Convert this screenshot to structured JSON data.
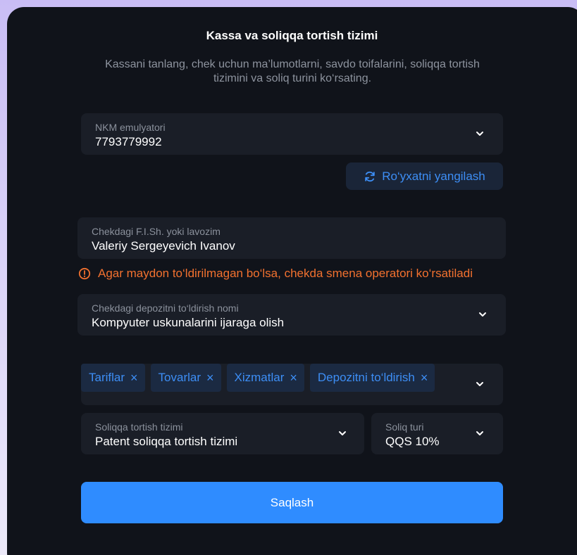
{
  "header": {
    "title": "Kassa va soliqqa tortish tizimi",
    "subtitle": "Kassani tanlang, chek uchun ma’lumotlarni, savdo toifalarini, soliqqa tortish tizimini va soliq turini ko‘rsating."
  },
  "cash_register": {
    "label": "NKM emulyatori",
    "value": "7793779992"
  },
  "refresh_button": {
    "label": "Ro‘yxatni yangilash"
  },
  "cashier_name": {
    "label": "Chekdagi F.I.Sh. yoki lavozim",
    "value": "Valeriy Sergeyevich Ivanov"
  },
  "warning": {
    "text": "Agar maydon to‘ldirilmagan bo‘lsa, chekda smena operatori ko‘rsatiladi"
  },
  "deposit": {
    "label": "Chekdagi depozitni to‘ldirish nomi",
    "value": "Kompyuter uskunalarini ijaraga olish"
  },
  "categories": {
    "tags": [
      "Tariflar",
      "Tovarlar",
      "Xizmatlar",
      "Depozitni to‘ldirish"
    ],
    "remove_glyph": "×"
  },
  "tax_system": {
    "label": "Soliqqa tortish tizimi",
    "value": "Patent soliqqa tortish tizimi"
  },
  "tax_type": {
    "label": "Soliq turi",
    "value": "QQS 10%"
  },
  "save_button": {
    "label": "Saqlash"
  },
  "colors": {
    "accent": "#2f8cff",
    "warning": "#f2712f",
    "panel": "#10131a",
    "field": "#1a1e27"
  },
  "icons": [
    "chevron-down-icon",
    "refresh-icon",
    "warning-icon",
    "close-icon"
  ]
}
